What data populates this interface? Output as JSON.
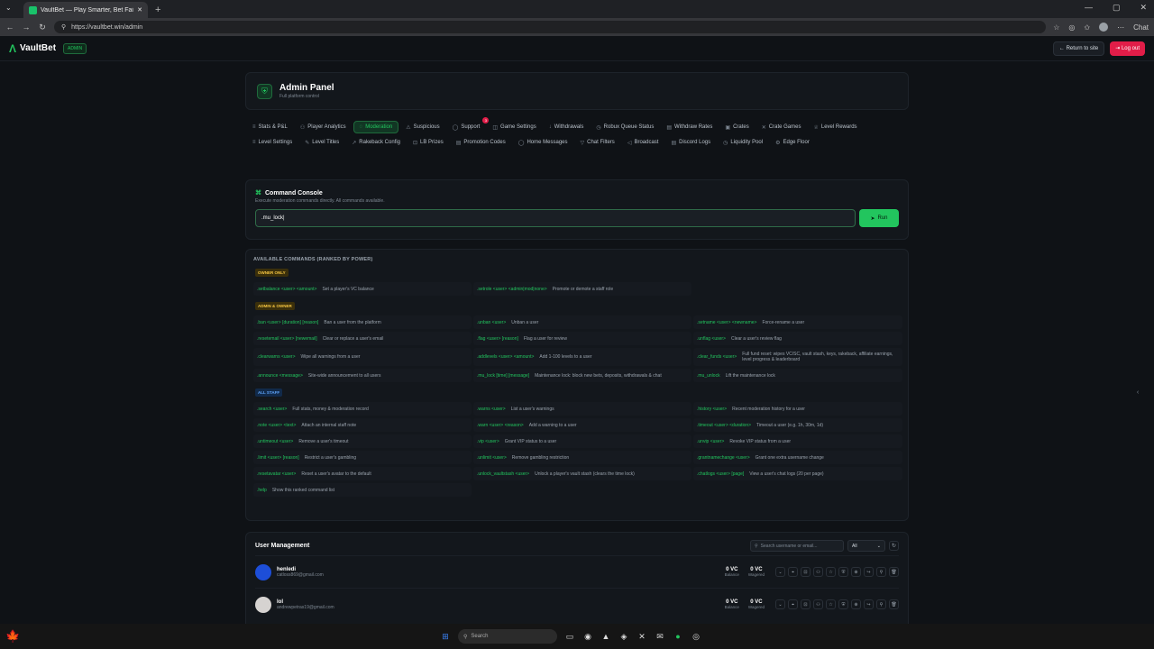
{
  "browser": {
    "tab_title": "VaultBet — Play Smarter, Bet Fairer",
    "url": "https://vaultbet.win/admin",
    "chat_label": "Chat",
    "new_tab": "+",
    "tab_close": "✕",
    "win_min": "—",
    "win_max": "▢",
    "win_close": "✕"
  },
  "header": {
    "logo_text": "VaultBet",
    "badge": "ADMIN",
    "return_label": "Return to site",
    "logout_label": "Log out"
  },
  "panel": {
    "title": "Admin Panel",
    "subtitle": "Full platform control"
  },
  "tabs": [
    {
      "icon": "≡",
      "label": "Stats & P&L"
    },
    {
      "icon": "⚇",
      "label": "Player Analytics"
    },
    {
      "icon": "◌",
      "label": "Moderation",
      "active": true
    },
    {
      "icon": "⚠",
      "label": "Suspicious"
    },
    {
      "icon": "◯",
      "label": "Support",
      "badge": "3"
    },
    {
      "icon": "◫",
      "label": "Game Settings"
    },
    {
      "icon": "↓",
      "label": "Withdrawals"
    },
    {
      "icon": "◷",
      "label": "Robux Queue Status"
    },
    {
      "icon": "▤",
      "label": "Withdraw Rates"
    },
    {
      "icon": "▣",
      "label": "Crates"
    },
    {
      "icon": "✕",
      "label": "Crate Games"
    },
    {
      "icon": "♕",
      "label": "Level Rewards"
    },
    {
      "icon": "≡",
      "label": "Level Settings"
    },
    {
      "icon": "✎",
      "label": "Level Titles"
    },
    {
      "icon": "↗",
      "label": "Rakeback Config"
    },
    {
      "icon": "⊡",
      "label": "LB Prizes"
    },
    {
      "icon": "▤",
      "label": "Promotion Codes"
    },
    {
      "icon": "◯",
      "label": "Home Messages"
    },
    {
      "icon": "▽",
      "label": "Chat Filters"
    },
    {
      "icon": "◁",
      "label": "Broadcast"
    },
    {
      "icon": "▤",
      "label": "Discord Logs"
    },
    {
      "icon": "◷",
      "label": "Liquidity Pool"
    },
    {
      "icon": "⚙",
      "label": "Edge Floor"
    }
  ],
  "console": {
    "title": "Command Console",
    "subtitle": "Execute moderation commands directly. All commands available.",
    "input_value": ".mu_lock",
    "run_label": "Run"
  },
  "commands": {
    "title": "AVAILABLE COMMANDS (RANKED BY POWER)",
    "groups": [
      {
        "label": "OWNER ONLY",
        "items": [
          {
            "cmd": ".setbalance <user> <amount>",
            "desc": "Set a player's VC balance"
          },
          {
            "cmd": ".setrole <user> <admin|mod|none>",
            "desc": "Promote or demote a staff role"
          }
        ]
      },
      {
        "label": "ADMIN & OWNER",
        "items": [
          {
            "cmd": ".ban <user> [duration] [reason]",
            "desc": "Ban a user from the platform"
          },
          {
            "cmd": ".unban <user>",
            "desc": "Unban a user"
          },
          {
            "cmd": ".setname <user> <newname>",
            "desc": "Force-rename a user"
          },
          {
            "cmd": ".resetemail <user> [newemail]",
            "desc": "Clear or replace a user's email"
          },
          {
            "cmd": ".flag <user> [reason]",
            "desc": "Flag a user for review"
          },
          {
            "cmd": ".unflag <user>",
            "desc": "Clear a user's review flag"
          },
          {
            "cmd": ".clearwarns <user>",
            "desc": "Wipe all warnings from a user"
          },
          {
            "cmd": ".addlevels <user> <amount>",
            "desc": "Add 1-100 levels to a user"
          },
          {
            "cmd": ".clear_funds <user>",
            "desc": "Full fund reset: wipes VC/SC, vault stash, keys, rakeback, affiliate earnings, level progress & leaderboard"
          },
          {
            "cmd": ".announce <message>",
            "desc": "Site-wide announcement to all users"
          },
          {
            "cmd": ".mu_lock [time] [message]",
            "desc": "Maintenance lock: block new bets, deposits, withdrawals & chat"
          },
          {
            "cmd": ".mu_unlock",
            "desc": "Lift the maintenance lock"
          }
        ]
      },
      {
        "label": "ALL STAFF",
        "items": [
          {
            "cmd": ".search <user>",
            "desc": "Full stats, money & moderation record"
          },
          {
            "cmd": ".warns <user>",
            "desc": "List a user's warnings"
          },
          {
            "cmd": ".history <user>",
            "desc": "Recent moderation history for a user"
          },
          {
            "cmd": ".note <user> <text>",
            "desc": "Attach an internal staff note"
          },
          {
            "cmd": ".warn <user> <reason>",
            "desc": "Add a warning to a user"
          },
          {
            "cmd": ".timeout <user> <duration>",
            "desc": "Timeout a user (e.g. 1h, 30m, 1d)"
          },
          {
            "cmd": ".untimeout <user>",
            "desc": "Remove a user's timeout"
          },
          {
            "cmd": ".vip <user>",
            "desc": "Grant VIP status to a user"
          },
          {
            "cmd": ".unvip <user>",
            "desc": "Revoke VIP status from a user"
          },
          {
            "cmd": ".limit <user> [reason]",
            "desc": "Restrict a user's gambling"
          },
          {
            "cmd": ".unlimit <user>",
            "desc": "Remove gambling restriction"
          },
          {
            "cmd": ".grantnamechange <user>",
            "desc": "Grant one extra username change"
          },
          {
            "cmd": ".resetavatar <user>",
            "desc": "Reset a user's avatar to the default"
          },
          {
            "cmd": ".unlock_vaultstash <user>",
            "desc": "Unlock a player's vault stash (clears the time lock)"
          },
          {
            "cmd": ".chatlogs <user> [page]",
            "desc": "View a user's chat logs (20 per page)"
          },
          {
            "cmd": ".help",
            "desc": "Show this ranked command list"
          }
        ]
      }
    ]
  },
  "users": {
    "title": "User Management",
    "search_placeholder": "Search username or email...",
    "filter_value": "All",
    "rows": [
      {
        "name": "henledi",
        "email": "catloss869@gmail.com",
        "balance": "0 VC",
        "balance_label": "Balance",
        "wagered": "0 VC",
        "wagered_label": "Wagered",
        "avatar_color": "#1d4ed8"
      },
      {
        "name": "lol",
        "email": "andrewpetras19@gmail.com",
        "balance": "0 VC",
        "balance_label": "Balance",
        "wagered": "0 VC",
        "wagered_label": "Wagered",
        "avatar_color": "#d6d3d1"
      }
    ]
  },
  "taskbar": {
    "search_label": "Search"
  },
  "colors": {
    "accent": "#22c55e",
    "danger": "#e11d48",
    "background": "#0f1216"
  }
}
